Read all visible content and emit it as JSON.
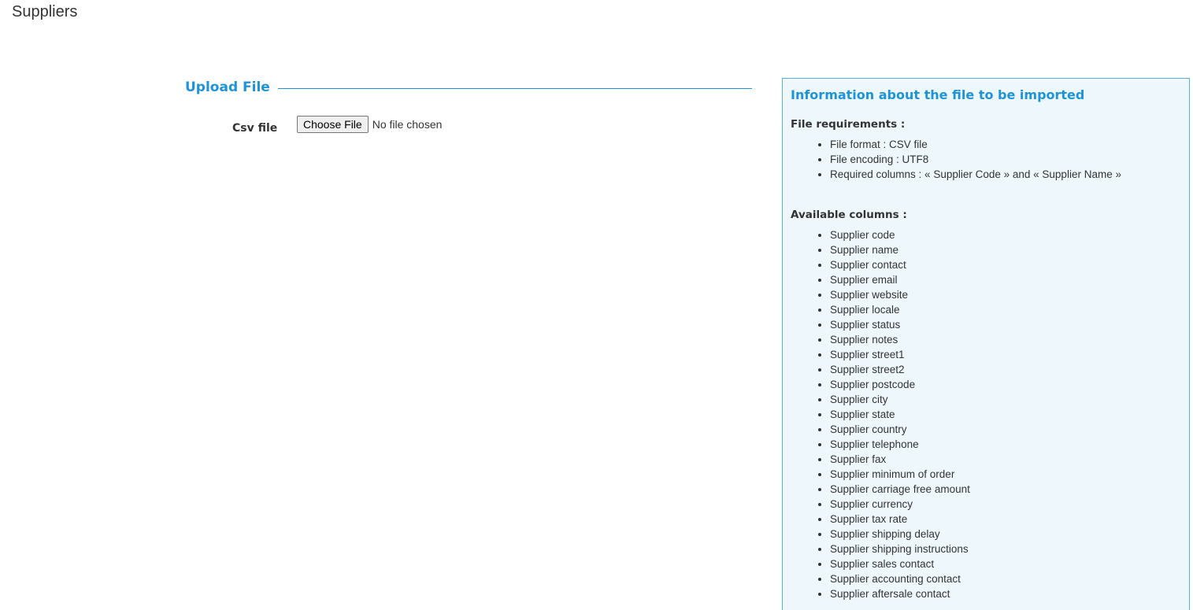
{
  "page": {
    "title": "Suppliers"
  },
  "upload": {
    "legend": "Upload File",
    "csv_label": "Csv file",
    "choose_button": "Choose File",
    "no_file_text": "No file chosen"
  },
  "info": {
    "title": "Information about the file to be imported",
    "requirements_heading": "File requirements :",
    "requirements": [
      "File format : CSV file",
      "File encoding : UTF8",
      "Required columns : « Supplier Code » and « Supplier Name »"
    ],
    "columns_heading": "Available columns :",
    "columns": [
      "Supplier code",
      "Supplier name",
      "Supplier contact",
      "Supplier email",
      "Supplier website",
      "Supplier locale",
      "Supplier status",
      "Supplier notes",
      "Supplier street1",
      "Supplier street2",
      "Supplier postcode",
      "Supplier city",
      "Supplier state",
      "Supplier country",
      "Supplier telephone",
      "Supplier fax",
      "Supplier minimum of order",
      "Supplier carriage free amount",
      "Supplier currency",
      "Supplier tax rate",
      "Supplier shipping delay",
      "Supplier shipping instructions",
      "Supplier sales contact",
      "Supplier accounting contact",
      "Supplier aftersale contact"
    ]
  },
  "colors": {
    "accent": "#1e94d8",
    "panel_bg": "#eef7fc",
    "panel_border": "#5fb0cf"
  }
}
